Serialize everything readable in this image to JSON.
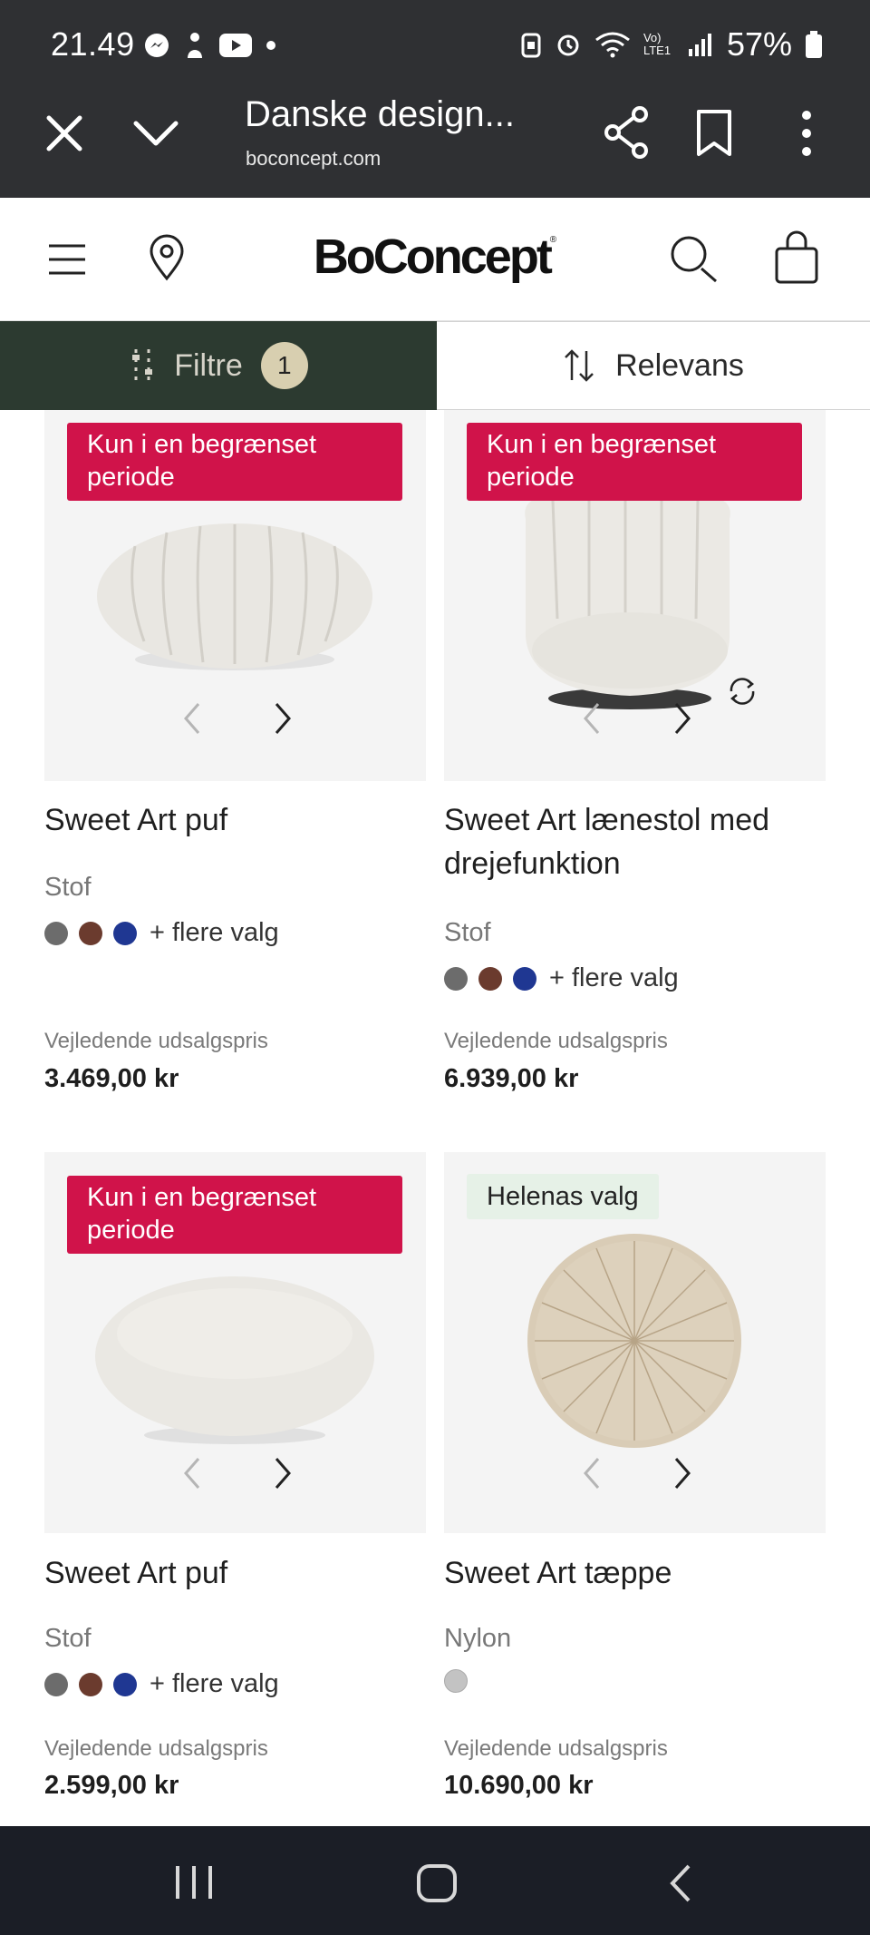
{
  "status_bar": {
    "time": "21.49",
    "battery": "57%",
    "network": "Vo) LTE1"
  },
  "browser": {
    "title": "Danske design...",
    "url": "boconcept.com"
  },
  "site": {
    "logo": "BoConcept"
  },
  "filter_bar": {
    "filter_label": "Filtre",
    "filter_count": "1",
    "sort_label": "Relevans"
  },
  "products": [
    {
      "badge": "Kun i en begrænset periode",
      "name": "Sweet Art puf",
      "material": "Stof",
      "swatches": [
        "#6c6c6c",
        "#6b3b2e",
        "#1f3792"
      ],
      "more": "+ flere valg",
      "price_label": "Vejledende udsalgspris",
      "price": "3.469,00 kr"
    },
    {
      "badge": "Kun i en begrænset periode",
      "name": "Sweet Art lænestol med drejefunktion",
      "material": "Stof",
      "swatches": [
        "#6c6c6c",
        "#6b3b2e",
        "#1f3792"
      ],
      "more": "+ flere valg",
      "price_label": "Vejledende udsalgspris",
      "price": "6.939,00 kr"
    },
    {
      "badge": "Kun i en begrænset periode",
      "name": "Sweet Art puf",
      "material": "Stof",
      "swatches": [
        "#6c6c6c",
        "#6b3b2e",
        "#1f3792"
      ],
      "more": "+ flere valg",
      "price_label": "Vejledende udsalgspris",
      "price": "2.599,00 kr"
    },
    {
      "badge": "Helenas valg",
      "name": "Sweet Art tæppe",
      "material": "Nylon",
      "swatches": [
        "#c3c3c3"
      ],
      "more": "",
      "price_label": "Vejledende udsalgspris",
      "price": "10.690,00 kr"
    }
  ]
}
